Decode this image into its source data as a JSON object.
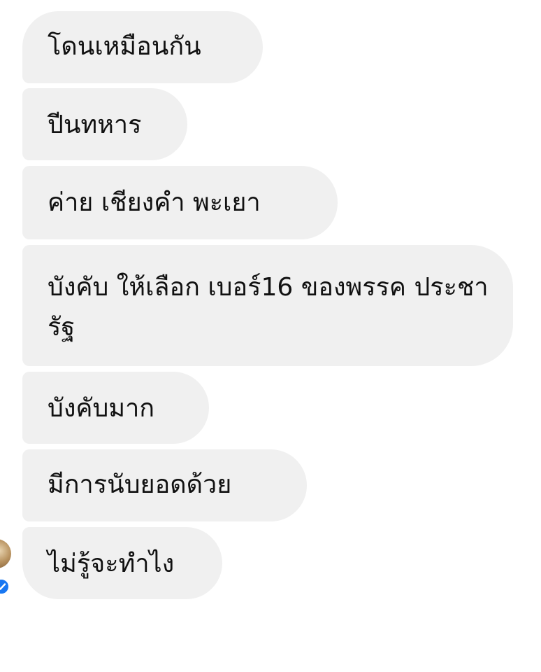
{
  "conversation": {
    "messages": [
      {
        "text": "โดนเหมือนกัน"
      },
      {
        "text": "ปีนทหาร"
      },
      {
        "text": "ค่าย เชียงคำ พะเยา"
      },
      {
        "text": "บังคับ ให้เลือก เบอร์16 ของพรรค ประชารัฐ"
      },
      {
        "text": "บังคับมาก"
      },
      {
        "text": "มีการนับยอดด้วย"
      },
      {
        "text": "ไม่รู้จะทำไง"
      }
    ],
    "bubble_color": "#f0f0f0",
    "text_color": "#111111",
    "seen_badge_color": "#1877f2",
    "avatar_icon": "sender-avatar",
    "seen_icon": "messenger-check-icon"
  }
}
